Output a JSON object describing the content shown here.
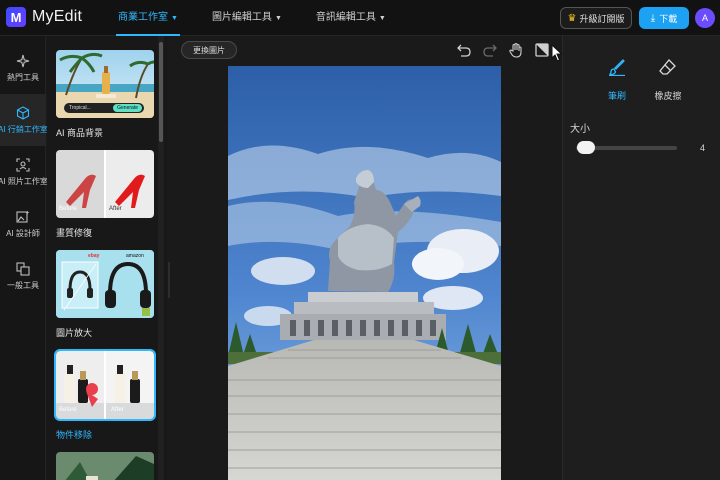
{
  "app": {
    "logo_letter": "M",
    "name": "MyEdit"
  },
  "nav": {
    "items": [
      {
        "label": "商業工作室",
        "active": true
      },
      {
        "label": "圖片編輯工具",
        "active": false
      },
      {
        "label": "音訊編輯工具",
        "active": false
      }
    ]
  },
  "header": {
    "upgrade_label": "升級訂閱版",
    "download_label": "下載",
    "avatar_letter": "A"
  },
  "rail": {
    "items": [
      {
        "label": "熱門工具",
        "icon": "sparkle-icon",
        "active": false
      },
      {
        "label": "AI 行銷工作室",
        "icon": "cube-icon",
        "active": true
      },
      {
        "label": "AI 照片工作室",
        "icon": "face-scan-icon",
        "active": false
      },
      {
        "label": "AI 設計師",
        "icon": "image-sparkle-icon",
        "active": false
      },
      {
        "label": "一般工具",
        "icon": "copy-icon",
        "active": false
      }
    ]
  },
  "templates": [
    {
      "label": "AI 商品背景",
      "badge_left": "Tropical...",
      "badge_right": "Generate"
    },
    {
      "label": "畫質修復",
      "before": "Before",
      "after": "After"
    },
    {
      "label": "圖片放大",
      "brand_1": "ebay",
      "brand_2": "amazon"
    },
    {
      "label": "物件移除",
      "before": "Before",
      "after": "After",
      "selected": true
    }
  ],
  "canvas": {
    "replace_label": "更換圖片",
    "tools": [
      "undo-icon",
      "redo-icon",
      "hand-icon",
      "compare-icon"
    ]
  },
  "panel": {
    "brush_label": "筆刷",
    "eraser_label": "橡皮擦",
    "size_label": "大小",
    "size_value": "4",
    "size_min": 1,
    "size_max": 100,
    "size_fraction": 0.03
  },
  "colors": {
    "accent": "#30b8ff",
    "download": "#1da1f2",
    "avatar": "#6c4cff"
  }
}
